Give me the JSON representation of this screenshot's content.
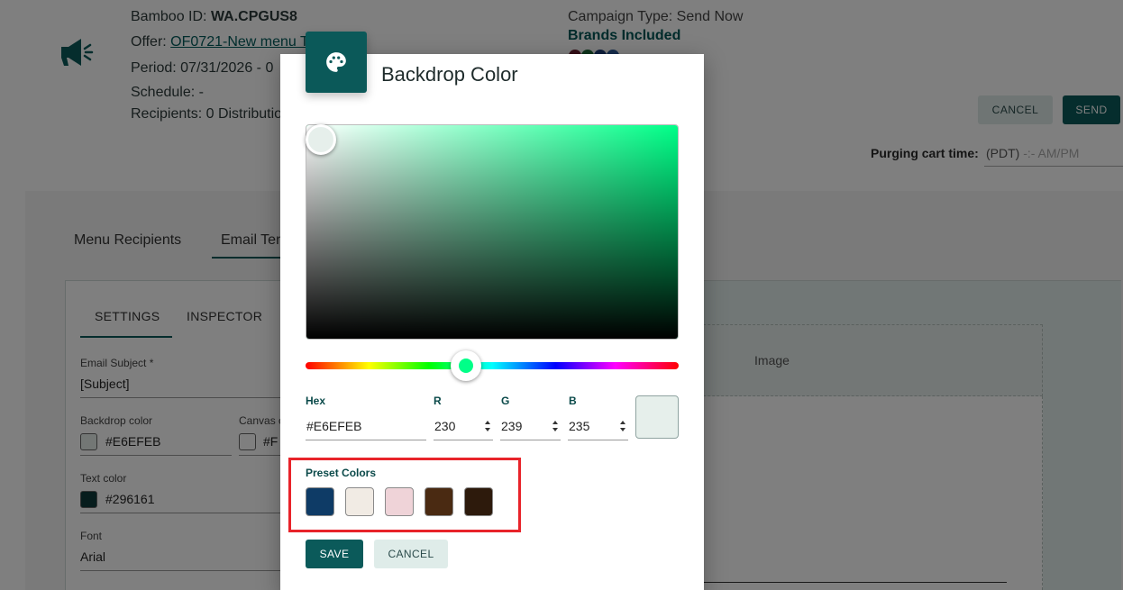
{
  "background": {
    "header": {
      "bamboo_label": "Bamboo ID:",
      "bamboo_value": "WA.CPGUS8",
      "offer_label": "Offer:",
      "offer_value": "OF0721-New menu T",
      "period": "Period: 07/31/2026 - 0",
      "schedule": "Schedule: -",
      "recipients": "Recipients: 0 Distributio",
      "campaign_type": "Campaign Type: Send Now",
      "brands_included": "Brands Included",
      "cancel_label": "CANCEL",
      "send_label": "SEND",
      "purge_label": "Purging cart time:",
      "purge_value": "(PDT)",
      "purge_placeholder": "-:- AM/PM"
    },
    "tabs": [
      "Menu Recipients",
      "Email Ten"
    ],
    "sub_tabs": [
      "SETTINGS",
      "INSPECTOR"
    ],
    "image_placeholder": "Image",
    "fields": {
      "email_subject_label": "Email Subject *",
      "email_subject_value": "[Subject]",
      "backdrop_label": "Backdrop color",
      "backdrop_value": "#E6EFEB",
      "canvas_label": "Canvas c",
      "canvas_value": "#F",
      "text_color_label": "Text color",
      "text_color_value": "#296161",
      "font_label": "Font",
      "font_value": "Arial"
    }
  },
  "modal": {
    "title": "Backdrop Color",
    "icon": "palette-icon",
    "picker": {
      "hue_color": "#00ff88",
      "selected_color": "#E6EFEB"
    },
    "inputs": {
      "hex_label": "Hex",
      "hex_value": "#E6EFEB",
      "r_label": "R",
      "r_value": "230",
      "g_label": "G",
      "g_value": "239",
      "b_label": "B",
      "b_value": "235"
    },
    "preset_label": "Preset Colors",
    "presets": [
      "#0e3b66",
      "#f1ebe4",
      "#efd3d8",
      "#4a2a12",
      "#2d1a0c"
    ],
    "save_label": "SAVE",
    "cancel_label": "CANCEL"
  }
}
